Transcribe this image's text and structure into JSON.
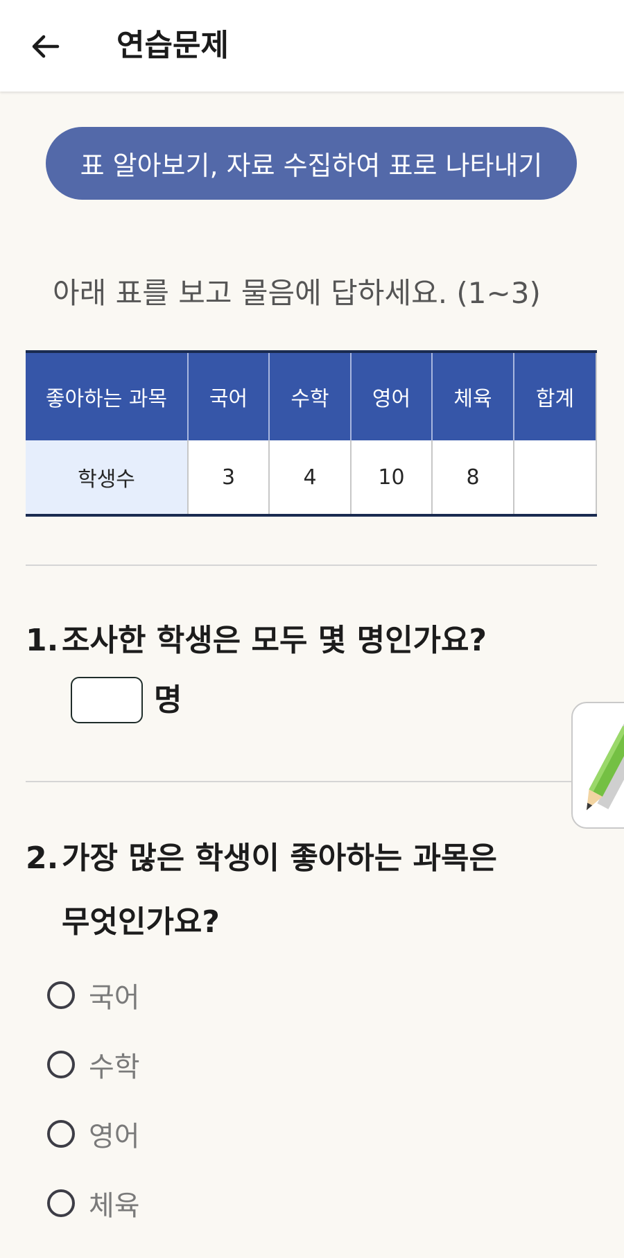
{
  "header": {
    "back_icon": "arrow-left-icon",
    "title": "연습문제"
  },
  "topic": "표 알아보기, 자료 수집하여 표로 나타내기",
  "instruction": "아래 표를 보고 물음에 답하세요. (1~3)",
  "table": {
    "headers": [
      "좋아하는 과목",
      "국어",
      "수학",
      "영어",
      "체육",
      "합계"
    ],
    "row_label": "학생수",
    "values": [
      "3",
      "4",
      "10",
      "8",
      ""
    ]
  },
  "question1": {
    "number": "1.",
    "text": "조사한 학생은 모두 몇 명인가요?",
    "answer_value": "",
    "unit": "명"
  },
  "question2": {
    "number": "2.",
    "text_line1": "가장 많은 학생이 좋아하는 과목은",
    "text_line2": "무엇인가요?",
    "options": [
      "국어",
      "수학",
      "영어",
      "체육"
    ]
  },
  "side_tool": {
    "icon": "pencil-icon"
  },
  "colors": {
    "accent_pill": "#5369a9",
    "table_header": "#3656a8",
    "row_label_bg": "#e6eefc",
    "background": "#faf8f3"
  }
}
